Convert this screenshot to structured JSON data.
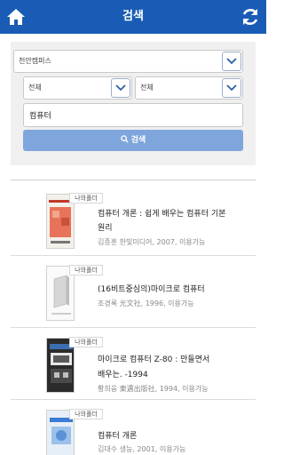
{
  "header": {
    "title": "검색",
    "accent": "#1a5cb5"
  },
  "search": {
    "campus": "천안캠퍼스",
    "type1": "전체",
    "type2": "전체",
    "keyword": "컴퓨터",
    "button_label": "검색",
    "button_color": "#7fa6dc"
  },
  "results": [
    {
      "folder_label": "나의폴더",
      "title_line1": "컴퓨터 개론 : 쉽게 배우는 컴퓨터 기본",
      "title_line2": "원리",
      "meta": "김종훈 한빛미디어, 2007, 이용가능"
    },
    {
      "folder_label": "나의폴더",
      "title_line1": "(16비트중심의)마이크로 컴퓨터",
      "title_line2": "",
      "meta": "조경록 光文社, 1996, 이용가능"
    },
    {
      "folder_label": "나의폴더",
      "title_line1": "마이크로 컴퓨터 Z-80 : 만들면서",
      "title_line2": "배우는. -1994",
      "meta": "황희융 東邁出版社, 1994, 이용가능"
    },
    {
      "folder_label": "나의폴더",
      "title_line1": "컴퓨터 개론",
      "title_line2": "",
      "meta": "김대수 생능, 2001, 이용가능"
    }
  ]
}
